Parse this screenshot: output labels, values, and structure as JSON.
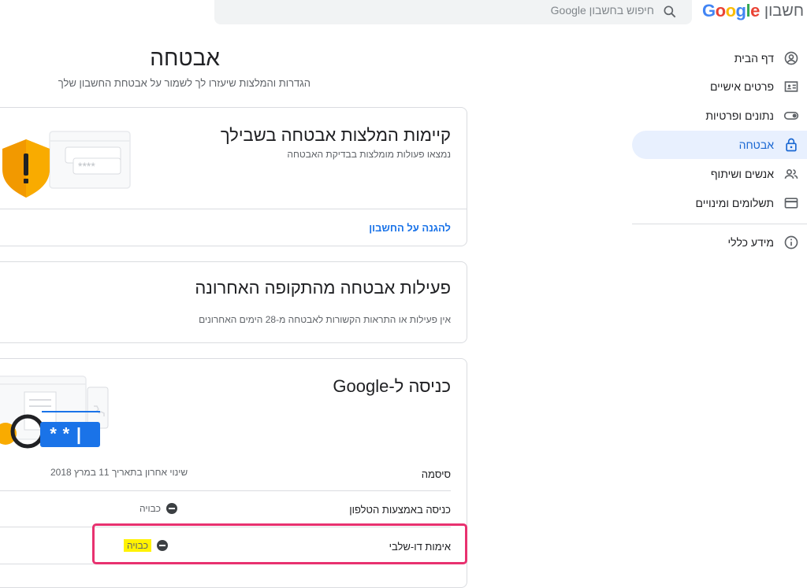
{
  "header": {
    "logo_text": "Google",
    "product": "חשבון",
    "search_placeholder": "חיפוש בחשבון Google"
  },
  "sidebar": {
    "items": [
      {
        "label": "דף הבית",
        "icon": "person-circle-icon"
      },
      {
        "label": "פרטים אישיים",
        "icon": "id-card-icon"
      },
      {
        "label": "נתונים ופרטיות",
        "icon": "toggle-icon"
      },
      {
        "label": "אבטחה",
        "icon": "lock-icon",
        "active": true
      },
      {
        "label": "אנשים ושיתוף",
        "icon": "people-icon"
      },
      {
        "label": "תשלומים ומינויים",
        "icon": "credit-card-icon"
      },
      {
        "label": "מידע כללי",
        "icon": "info-icon"
      }
    ]
  },
  "main": {
    "title": "אבטחה",
    "subtitle": "הגדרות והמלצות שיעזרו לך לשמור על אבטחת החשבון שלך",
    "recommendations": {
      "title": "קיימות המלצות אבטחה בשבילך",
      "desc": "נמצאו פעולות מומלצות בבדיקת האבטחה",
      "link": "להגנה על החשבון"
    },
    "recent_activity": {
      "title": "פעילות אבטחה מהתקופה האחרונה",
      "desc": "אין פעילות או התראות הקשורות לאבטחה מ-28 הימים האחרונים"
    },
    "signin": {
      "title": "כניסה ל-Google",
      "graphic_password": "**|",
      "rows": [
        {
          "label": "סיסמה",
          "value": "שינוי אחרון בתאריך 11 במרץ 2018"
        },
        {
          "label": "כניסה באמצעות הטלפון",
          "value": "כבויה"
        },
        {
          "label": "אימות דו-שלבי",
          "value": "כבויה"
        }
      ]
    }
  },
  "colors": {
    "accent": "#1a73e8",
    "active_bg": "#e8f0fe",
    "highlight": "#fff200",
    "annotation": "#e8316f"
  }
}
